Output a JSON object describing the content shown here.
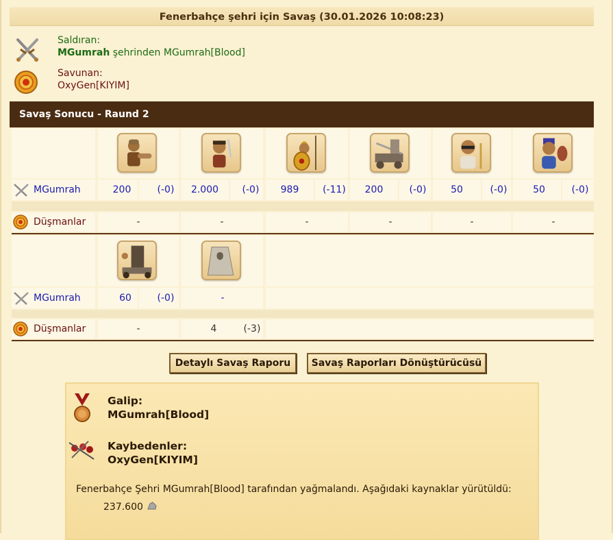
{
  "title": "Fenerbahçe şehri için Savaş (30.01.2026 10:08:23)",
  "attacker": {
    "heading": "Saldıran:",
    "name": "MGumrah",
    "detail": " şehrinden MGumrah[Blood]"
  },
  "defender": {
    "heading": "Savunan:",
    "name": "OxyGen[KIYIM]"
  },
  "section_title": "Savaş Sonucu - Raund 2",
  "table1": {
    "attacker_label": "MGumrah",
    "enemy_label": "Düşmanlar",
    "units": [
      {
        "icon": "hoplite-unit-icon",
        "count": "200",
        "loss": "(-0)",
        "enemy": "-"
      },
      {
        "icon": "swordsman-unit-icon",
        "count": "2.000",
        "loss": "(-0)",
        "enemy": "-"
      },
      {
        "icon": "spearman-unit-icon",
        "count": "989",
        "loss": "(-11)",
        "enemy": "-"
      },
      {
        "icon": "catapult-unit-icon",
        "count": "200",
        "loss": "(-0)",
        "enemy": "-"
      },
      {
        "icon": "doctor-unit-icon",
        "count": "50",
        "loss": "(-0)",
        "enemy": "-"
      },
      {
        "icon": "cook-unit-icon",
        "count": "50",
        "loss": "(-0)",
        "enemy": "-"
      }
    ]
  },
  "table2": {
    "attacker_label": "MGumrah",
    "enemy_label": "Düşmanlar",
    "units": [
      {
        "icon": "siege-tower-unit-icon",
        "count": "60",
        "loss": "(-0)",
        "enemy": "-",
        "enemy_loss": ""
      },
      {
        "icon": "wall-unit-icon",
        "count": "-",
        "loss": "",
        "enemy": "4",
        "enemy_loss": "(-3)"
      }
    ]
  },
  "buttons": {
    "detail_report": "Detaylı Savaş Raporu",
    "converter": "Savaş Raporları Dönüştürücüsü"
  },
  "result": {
    "winner_label": "Galip:",
    "winner": "MGumrah[Blood]",
    "loser_label": "Kaybedenler:",
    "loser": "OxyGen[KIYIM]",
    "loot_text": "Fenerbahçe Şehri MGumrah[Blood] tarafından yağmalandı. Aşağıdaki kaynaklar yürütüldü:",
    "loot_amount": "237.600",
    "loot_icon": "marble-resource-icon"
  },
  "colors": {
    "background": "#fbf1d3",
    "section_bar": "#4a2c12",
    "attacker_green": "#1c6b14",
    "defender_maroon": "#6a1010",
    "numbers_blue": "#1a1ab0"
  }
}
